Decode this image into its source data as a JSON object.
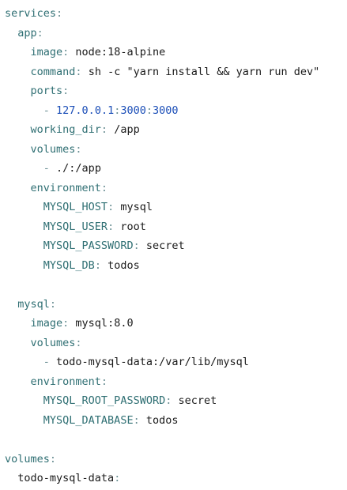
{
  "lines": [
    {
      "indent": "",
      "key": "services",
      "colon": ":",
      "value": ""
    },
    {
      "indent": "  ",
      "key": "app",
      "colon": ":",
      "value": ""
    },
    {
      "indent": "    ",
      "key": "image",
      "colon": ":",
      "value": " node:18-alpine"
    },
    {
      "indent": "    ",
      "key": "command",
      "colon": ":",
      "value": " sh -c \"yarn install && yarn run dev\""
    },
    {
      "indent": "    ",
      "key": "ports",
      "colon": ":",
      "value": ""
    },
    {
      "indent": "      ",
      "dash": "- ",
      "parts": [
        {
          "text": "127.0.0.1",
          "kind": "num"
        },
        {
          "text": ":",
          "kind": "punct"
        },
        {
          "text": "3000",
          "kind": "num"
        },
        {
          "text": ":",
          "kind": "punct"
        },
        {
          "text": "3000",
          "kind": "num"
        }
      ]
    },
    {
      "indent": "    ",
      "key": "working_dir",
      "colon": ":",
      "value": " /app"
    },
    {
      "indent": "    ",
      "key": "volumes",
      "colon": ":",
      "value": ""
    },
    {
      "indent": "      ",
      "dash": "- ",
      "value": "./:/app"
    },
    {
      "indent": "    ",
      "key": "environment",
      "colon": ":",
      "value": ""
    },
    {
      "indent": "      ",
      "key": "MYSQL_HOST",
      "colon": ":",
      "value": " mysql"
    },
    {
      "indent": "      ",
      "key": "MYSQL_USER",
      "colon": ":",
      "value": " root"
    },
    {
      "indent": "      ",
      "key": "MYSQL_PASSWORD",
      "colon": ":",
      "value": " secret"
    },
    {
      "indent": "      ",
      "key": "MYSQL_DB",
      "colon": ":",
      "value": " todos"
    },
    {
      "blank": true
    },
    {
      "indent": "  ",
      "key": "mysql",
      "colon": ":",
      "value": ""
    },
    {
      "indent": "    ",
      "key": "image",
      "colon": ":",
      "value": " mysql:8.0"
    },
    {
      "indent": "    ",
      "key": "volumes",
      "colon": ":",
      "value": ""
    },
    {
      "indent": "      ",
      "dash": "- ",
      "value": "todo-mysql-data:/var/lib/mysql"
    },
    {
      "indent": "    ",
      "key": "environment",
      "colon": ":",
      "value": ""
    },
    {
      "indent": "      ",
      "key": "MYSQL_ROOT_PASSWORD",
      "colon": ":",
      "value": " secret"
    },
    {
      "indent": "      ",
      "key": "MYSQL_DATABASE",
      "colon": ":",
      "value": " todos"
    },
    {
      "blank": true
    },
    {
      "indent": "",
      "key": "volumes",
      "colon": ":",
      "value": ""
    },
    {
      "indent": "  ",
      "key": "todo-mysql-data",
      "colon": ":",
      "value": "",
      "plainKey": true
    }
  ],
  "colors": {
    "key": "#2f6f73",
    "punct": "#6a8f93",
    "value": "#1a1a1a",
    "number": "#1c4fb8"
  }
}
